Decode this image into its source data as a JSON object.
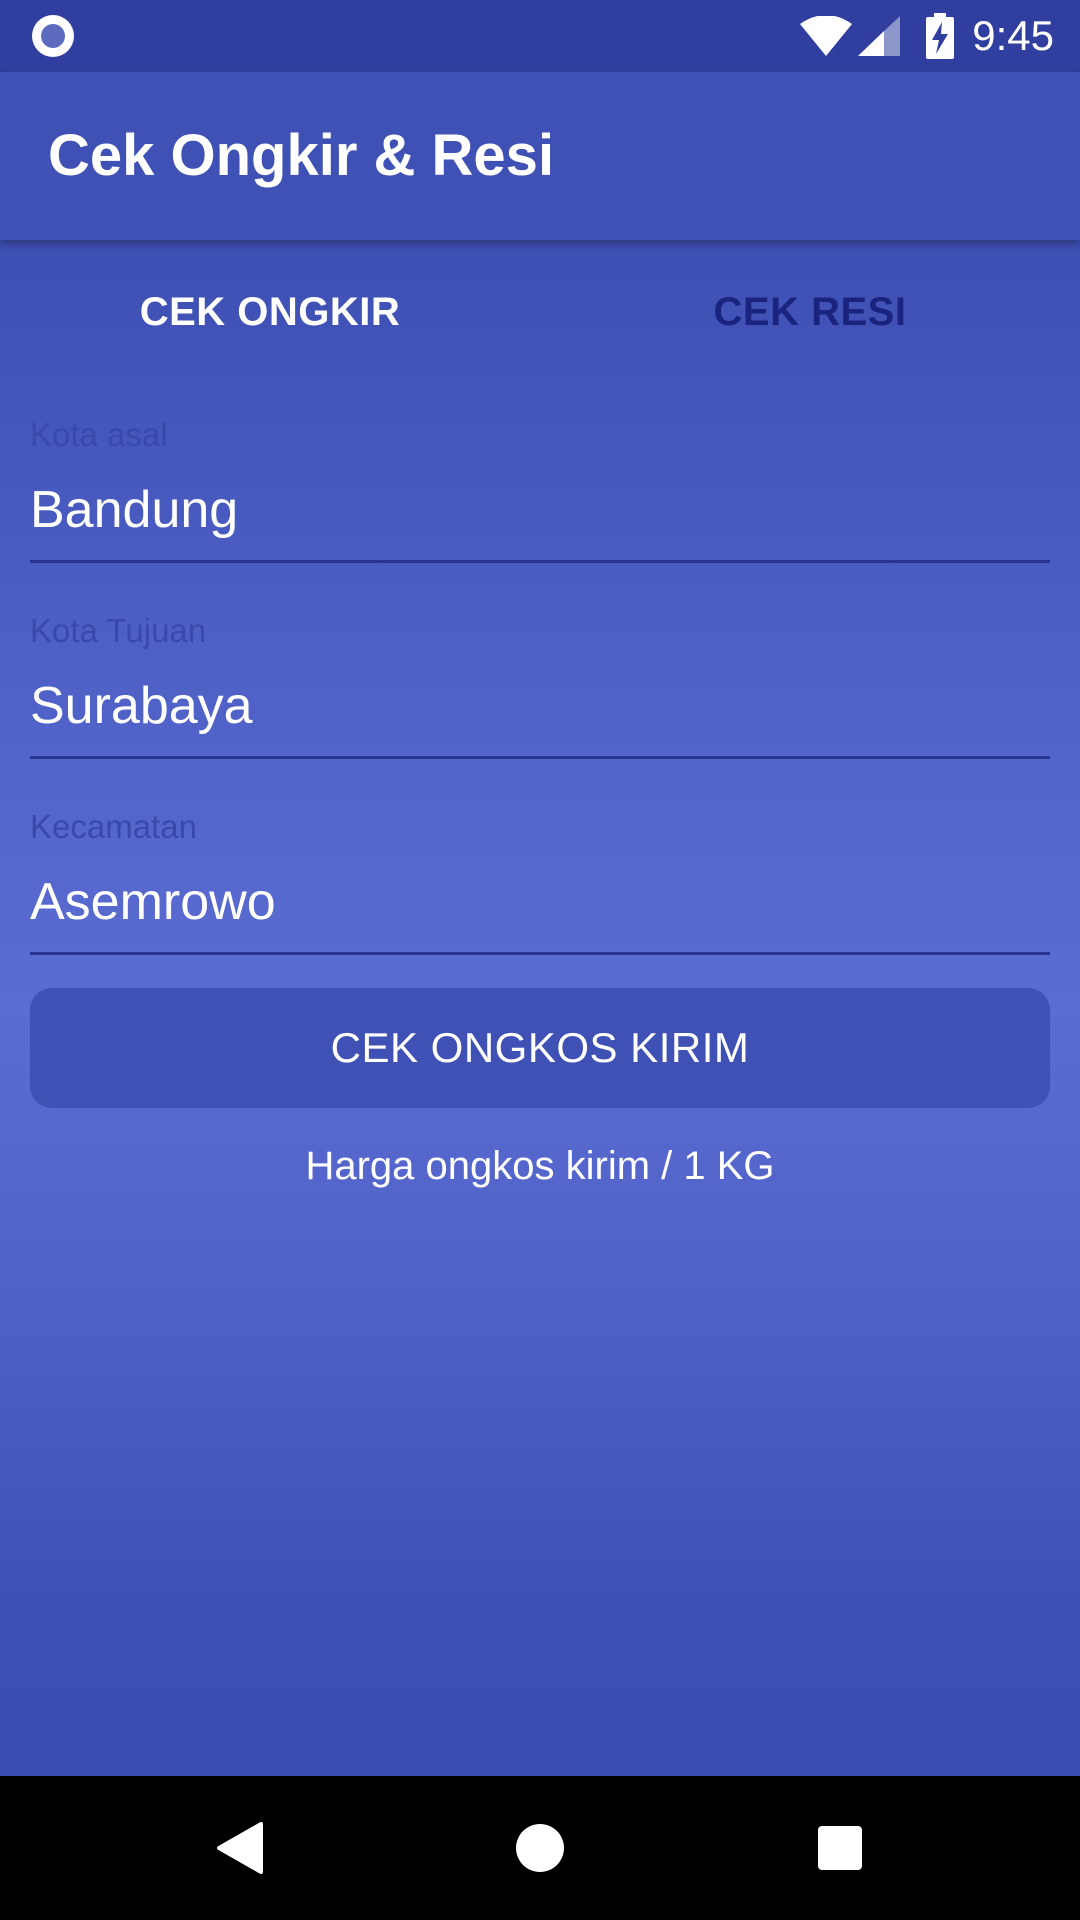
{
  "status_bar": {
    "time": "9:45",
    "icons": [
      "notification-circle-icon",
      "wifi-icon",
      "signal-icon",
      "battery-charging-icon"
    ]
  },
  "app_bar": {
    "title": "Cek Ongkir & Resi"
  },
  "tabs": [
    {
      "label": "CEK ONGKIR",
      "selected": true
    },
    {
      "label": "CEK RESI",
      "selected": false
    }
  ],
  "form": {
    "origin": {
      "label": "Kota asal",
      "value": "Bandung"
    },
    "destination": {
      "label": "Kota Tujuan",
      "value": "Surabaya"
    },
    "district": {
      "label": "Kecamatan",
      "value": "Asemrowo"
    }
  },
  "submit_button_label": "CEK ONGKOS KIRIM",
  "result_text": "Harga ongkos kirim / 1 KG",
  "nav_bar": {
    "buttons": [
      "back-icon",
      "home-icon",
      "recent-apps-icon"
    ]
  },
  "colors": {
    "primary": "#3f51b5",
    "primary_dark": "#303f9f",
    "tab_inactive": "#1a237e",
    "label": "#3949ab"
  }
}
